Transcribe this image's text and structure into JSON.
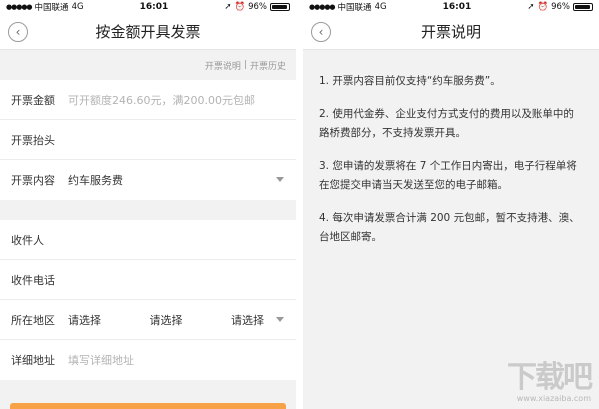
{
  "left": {
    "status": {
      "carrier": "中国联通",
      "network": "4G",
      "time": "16:01",
      "battery": "96%"
    },
    "title": "按金额开具发票",
    "links": {
      "explain": "开票说明",
      "separator": "|",
      "history": "开票历史"
    },
    "form": {
      "amount_label": "开票金额",
      "amount_placeholder": "可开额度246.60元，满200.00元包邮",
      "header_label": "开票抬头",
      "content_label": "开票内容",
      "content_value": "约车服务费",
      "recipient_label": "收件人",
      "phone_label": "收件电话",
      "region_label": "所在地区",
      "region_province": "请选择",
      "region_city": "请选择",
      "region_district": "请选择",
      "address_label": "详细地址",
      "address_placeholder": "填写详细地址"
    }
  },
  "right": {
    "status": {
      "carrier": "中国联通",
      "network": "4G",
      "time": "16:01",
      "battery": "96%"
    },
    "title": "开票说明",
    "items": [
      "1. 开票内容目前仅支持“约车服务费”。",
      "2. 使用代金券、企业支付方式支付的费用以及账单中的路桥费部分，不支持发票开具。",
      "3. 您申请的发票将在 7 个工作日内寄出，电子行程单将在您提交申请当天发送至您的电子邮箱。",
      "4. 每次申请发票合计满 200 元包邮，暂不支持港、澳、台地区邮寄。"
    ],
    "watermark": {
      "big": "下载吧",
      "small": "www.xiazaiba.com"
    }
  }
}
